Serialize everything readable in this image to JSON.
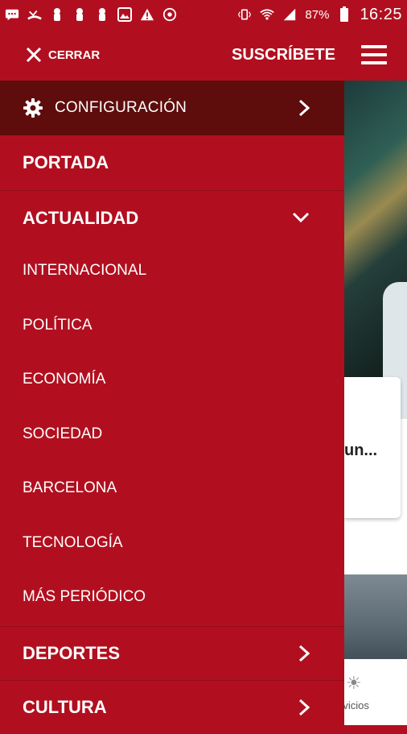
{
  "status_bar": {
    "battery_percent": "87%",
    "time": "16:25",
    "icons": [
      "messages-icon",
      "missed-call-icon",
      "notification-icon",
      "notification-icon",
      "notification-icon",
      "image-icon",
      "warning-icon",
      "sync-icon",
      "vibrate-icon",
      "wifi-icon",
      "signal-icon",
      "battery-icon"
    ]
  },
  "appbar": {
    "close_label": "CERRAR",
    "subscribe_label": "SUSCRÍBETE"
  },
  "drawer": {
    "config_label": "CONFIGURACIÓN",
    "items": [
      {
        "label": "PORTADA"
      },
      {
        "label": "ACTUALIDAD"
      },
      {
        "label": "INTERNACIONAL"
      },
      {
        "label": "POLÍTICA"
      },
      {
        "label": "ECONOMÍA"
      },
      {
        "label": "SOCIEDAD"
      },
      {
        "label": "BARCELONA"
      },
      {
        "label": "TECNOLOGÍA"
      },
      {
        "label": "MÁS PERIÓDICO"
      },
      {
        "label": "DEPORTES"
      },
      {
        "label": "CULTURA"
      }
    ]
  },
  "background": {
    "card_text": "un...",
    "tab_text": "rvicios"
  },
  "colors": {
    "brand_red": "#b10f1f",
    "config_dark": "#5e0d0c",
    "text": "#ffffff"
  }
}
